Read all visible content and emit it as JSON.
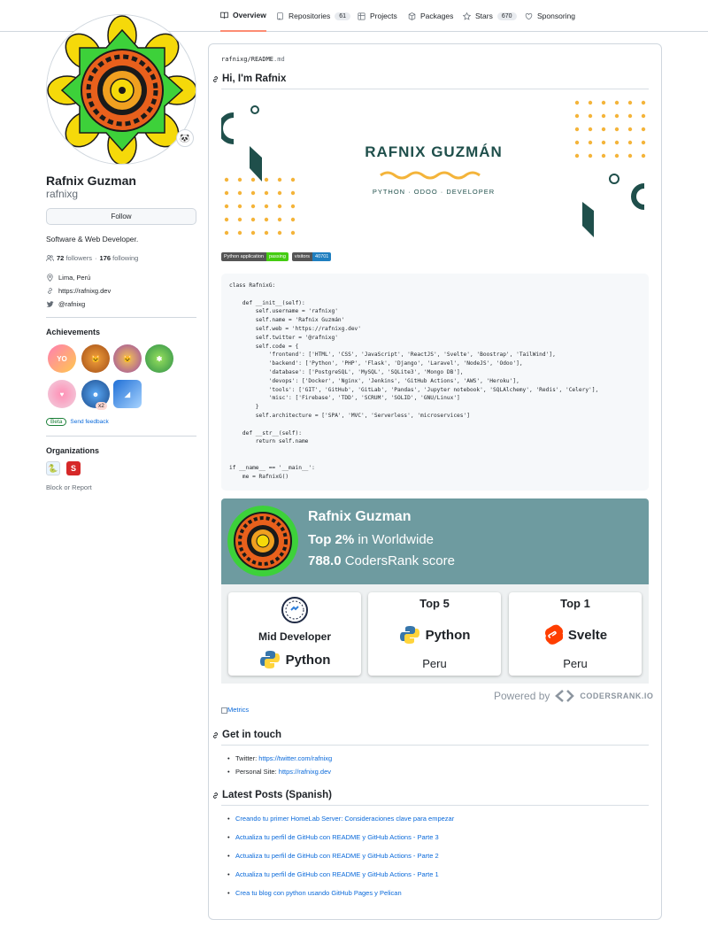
{
  "nav": {
    "tabs": [
      {
        "label": "Overview",
        "count": null,
        "icon": "book-icon"
      },
      {
        "label": "Repositories",
        "count": "61",
        "icon": "repo-icon"
      },
      {
        "label": "Projects",
        "count": null,
        "icon": "project-icon"
      },
      {
        "label": "Packages",
        "count": null,
        "icon": "package-icon"
      },
      {
        "label": "Stars",
        "count": "670",
        "icon": "star-icon"
      },
      {
        "label": "Sponsoring",
        "count": null,
        "icon": "heart-icon"
      }
    ]
  },
  "profile": {
    "name": "Rafnix Guzman",
    "login": "rafnixg",
    "follow_label": "Follow",
    "bio": "Software & Web Developer.",
    "followers": "72",
    "followers_label": "followers",
    "following": "176",
    "following_label": "following",
    "location": "Lima, Perú",
    "website": "https://rafnixg.dev",
    "twitter": "@rafnixg"
  },
  "achievements": {
    "title": "Achievements",
    "multiplier": "x2",
    "beta_label": "Beta",
    "feedback_label": "Send feedback"
  },
  "organizations": {
    "title": "Organizations",
    "block_label": "Block or Report"
  },
  "readme": {
    "breadcrumb_user": "rafnixg",
    "breadcrumb_sep": "/",
    "breadcrumb_file": "README",
    "breadcrumb_ext": ".md",
    "heading": "Hi, I'm Rafnix",
    "banner_title": "RAFNIX GUZMÁN",
    "banner_subtitle": "PYTHON · ODOO · DEVELOPER",
    "badge1_left": "Python application",
    "badge1_right": "passing",
    "badge2_left": "visitors",
    "badge2_right": "40701",
    "code": "class RafnixG:\n\n    def __init__(self):\n        self.username = 'rafnixg'\n        self.name = 'Rafnix Guzmán'\n        self.web = 'https://rafnixg.dev'\n        self.twitter = '@rafnixg'\n        self.code = {\n            'frontend': ['HTML', 'CSS', 'JavaScript', 'ReactJS', 'Svelte', 'Boostrap', 'TailWind'],\n            'backend': ['Python', 'PHP', 'Flask', 'Django', 'Laravel', 'NodeJS', 'Odoo'],\n            'database': ['PostgreSQL', 'MySQL', 'SQLite3', 'Mongo DB'],\n            'devops': ['Docker', 'Nginx', 'Jenkins', 'GitHub Actions', 'AWS', 'Heroku'],\n            'tools': ['GIT', 'GitHub', 'GitLab', 'Pandas', 'Jupyter notebook', 'SQLAlchemy', 'Redis', 'Celery'],\n            'misc': ['Firebase', 'TDD', 'SCRUM', 'SOLID', 'GNU/Linux']\n        }\n        self.architecture = ['SPA', 'MVC', 'Serverless', 'microservices']\n\n    def __str__(self):\n        return self.name\n\n\nif __name__ == '__main__':\n    me = RafnixG()"
  },
  "codersrank": {
    "name": "Rafnix Guzman",
    "top_percent": "Top 2%",
    "scope": "in Worldwide",
    "score": "788.0",
    "score_label": "CodersRank score",
    "box1_title": "Mid Developer",
    "box1_lang": "Python",
    "box2_title": "Top 5",
    "box2_lang": "Python",
    "box2_loc": "Peru",
    "box3_title": "Top 1",
    "box3_lang": "Svelte",
    "box3_loc": "Peru",
    "powered_by": "Powered by",
    "brand": "CODERSRANK.IO",
    "metrics_alt": "Metrics"
  },
  "contact": {
    "heading": "Get in touch",
    "twitter_label": "Twitter:",
    "twitter_url": "https://twitter.com/rafnixg",
    "site_label": "Personal Site:",
    "site_url": "https://rafnixg.dev"
  },
  "posts": {
    "heading": "Latest Posts (Spanish)",
    "items": [
      "Creando tu primer HomeLab Server: Consideraciones clave para empezar",
      "Actualiza tu perfil de GitHub con README y GitHub Actions - Parte 3",
      "Actualiza tu perfil de GitHub con README y GitHub Actions - Parte 2",
      "Actualiza tu perfil de GitHub con README y GitHub Actions - Parte 1",
      "Crea tu blog con python usando GitHub Pages y Pelican"
    ]
  },
  "colors": {
    "accent": "#0969da",
    "tab_underline": "#fd8c73",
    "codersrank_header": "#6e9ba0",
    "banner_text": "#1f4f4b",
    "banner_gold": "#f4b43a"
  }
}
